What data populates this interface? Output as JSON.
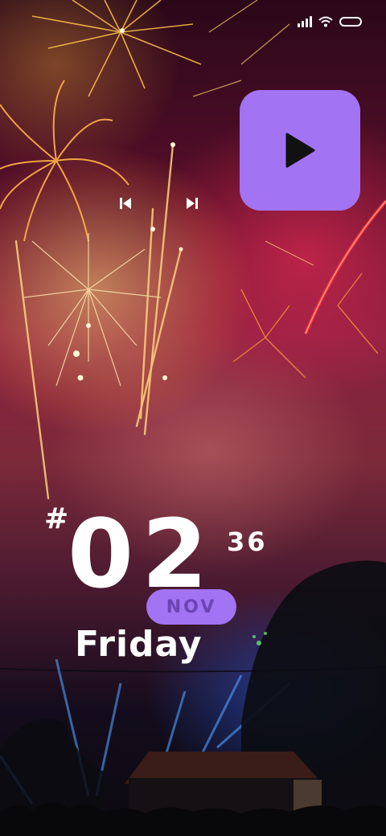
{
  "status_bar": {
    "icons": [
      "signal-icon",
      "wifi-icon",
      "battery-icon"
    ]
  },
  "media": {
    "play_icon": "play-icon",
    "prev_icon": "skip-previous-icon",
    "next_icon": "skip-next-icon"
  },
  "clock": {
    "prefix": "#",
    "hour": "02",
    "minute": "36",
    "month": "NOV",
    "weekday": "Friday"
  },
  "colors": {
    "accent": "#a273f2",
    "accent_text": "#6b44b6",
    "text": "#ffffff"
  },
  "wallpaper": "fireworks-night-scene"
}
